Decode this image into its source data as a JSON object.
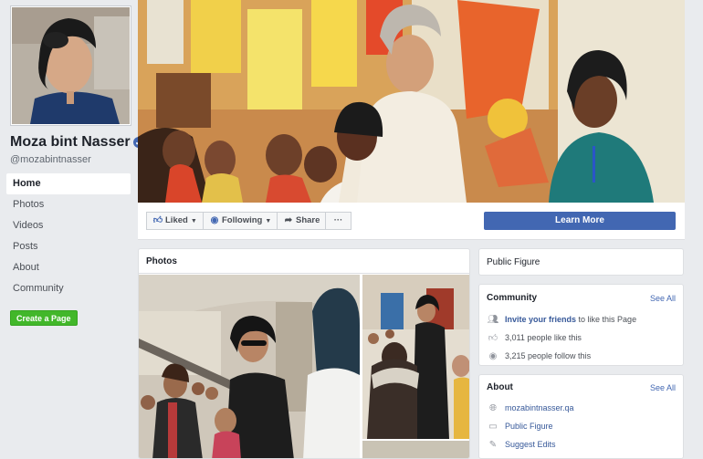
{
  "page": {
    "name": "Moza bint Nasser",
    "username": "@mozabintnasser"
  },
  "sidebar": {
    "items": [
      {
        "label": "Home",
        "active": true
      },
      {
        "label": "Photos"
      },
      {
        "label": "Videos"
      },
      {
        "label": "Posts"
      },
      {
        "label": "About"
      },
      {
        "label": "Community"
      }
    ],
    "create_page": "Create a Page"
  },
  "actions": {
    "liked": "Liked",
    "following": "Following",
    "share": "Share",
    "more": "···",
    "learn_more": "Learn More"
  },
  "photos": {
    "title": "Photos"
  },
  "category": {
    "label": "Public Figure"
  },
  "community": {
    "title": "Community",
    "see_all": "See All",
    "invite_link": "Invite your friends",
    "invite_suffix": " to like this Page",
    "likes": "3,011 people like this",
    "follows": "3,215 people follow this"
  },
  "about": {
    "title": "About",
    "see_all": "See All",
    "website": "mozabintnasser.qa",
    "category": "Public Figure",
    "suggest": "Suggest Edits"
  },
  "icons": {
    "verified": "verified-badge-icon",
    "like": "thumbs-up-icon",
    "rss": "rss-icon",
    "share": "share-arrow-icon",
    "community": "people-icon",
    "globe": "globe-icon",
    "tag": "tag-icon",
    "pencil": "pencil-icon"
  },
  "colors": {
    "brand": "#4267b2",
    "green": "#42b72a",
    "link": "#365899",
    "background": "#e9ebee"
  }
}
